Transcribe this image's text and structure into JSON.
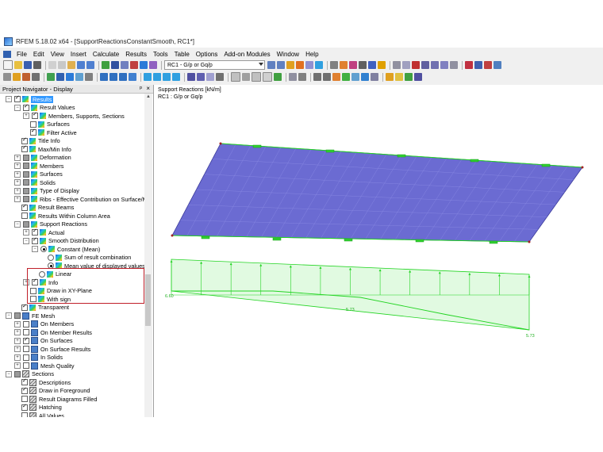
{
  "window": {
    "title": "RFEM 5.18.02 x64 - [SupportReactionsConstantSmooth, RC1*]"
  },
  "menu": [
    "File",
    "Edit",
    "View",
    "Insert",
    "Calculate",
    "Results",
    "Tools",
    "Table",
    "Options",
    "Add-on Modules",
    "Window",
    "Help"
  ],
  "toolbar": {
    "loadcase_combo": "RC1 - G/p or Gq/p"
  },
  "navigator": {
    "title": "Project Navigator - Display",
    "pin": "ᵖ",
    "close": "×",
    "items": [
      {
        "label": "Results",
        "level": 0,
        "exp": "-",
        "cb": "on",
        "icon": "res",
        "selected": true
      },
      {
        "label": "Result Values",
        "level": 1,
        "exp": "-",
        "cb": "on",
        "icon": "res"
      },
      {
        "label": "Members, Supports, Sections",
        "level": 2,
        "exp": "+",
        "cb": "on",
        "icon": "res"
      },
      {
        "label": "Surfaces",
        "level": 2,
        "exp": "",
        "cb": "off",
        "icon": "res"
      },
      {
        "label": "Filter Active",
        "level": 2,
        "exp": "",
        "cb": "on",
        "icon": "res"
      },
      {
        "label": "Title Info",
        "level": 1,
        "exp": "",
        "cb": "on",
        "icon": "res"
      },
      {
        "label": "Max/Min Info",
        "level": 1,
        "exp": "",
        "cb": "on",
        "icon": "res"
      },
      {
        "label": "Deformation",
        "level": 1,
        "exp": "+",
        "cb": "part",
        "icon": "res"
      },
      {
        "label": "Members",
        "level": 1,
        "exp": "+",
        "cb": "part",
        "icon": "res"
      },
      {
        "label": "Surfaces",
        "level": 1,
        "exp": "+",
        "cb": "part",
        "icon": "res"
      },
      {
        "label": "Solids",
        "level": 1,
        "exp": "+",
        "cb": "part",
        "icon": "res"
      },
      {
        "label": "Type of Display",
        "level": 1,
        "exp": "+",
        "cb": "part",
        "icon": "res"
      },
      {
        "label": "Ribs - Effective Contribution on Surface/Me",
        "level": 1,
        "exp": "+",
        "cb": "part",
        "icon": "res"
      },
      {
        "label": "Result Beams",
        "level": 1,
        "exp": "",
        "cb": "on",
        "icon": "res"
      },
      {
        "label": "Results Within Column Area",
        "level": 1,
        "exp": "",
        "cb": "off",
        "icon": "res"
      },
      {
        "label": "Support Reactions",
        "level": 1,
        "exp": "-",
        "cb": "part",
        "icon": "res"
      },
      {
        "label": "Actual",
        "level": 2,
        "exp": "+",
        "cb": "on",
        "icon": "res"
      },
      {
        "label": "Smooth Distribution",
        "level": 2,
        "exp": "-",
        "cb": "on",
        "icon": "res"
      },
      {
        "label": "Constant (Mean)",
        "level": 3,
        "exp": "-",
        "rad": "on",
        "icon": "res"
      },
      {
        "label": "Sum of result combination",
        "level": 4,
        "exp": "",
        "rad": "off",
        "icon": "res"
      },
      {
        "label": "Mean value of displayed values",
        "level": 4,
        "exp": "",
        "rad": "on",
        "icon": "res"
      },
      {
        "label": "Linear",
        "level": 3,
        "exp": "",
        "rad": "off",
        "icon": "res"
      },
      {
        "label": "Info",
        "level": 2,
        "exp": "+",
        "cb": "on",
        "icon": "res"
      },
      {
        "label": "Draw in XY-Plane",
        "level": 2,
        "exp": "",
        "cb": "off",
        "icon": "res"
      },
      {
        "label": "With sign",
        "level": 2,
        "exp": "",
        "cb": "off",
        "icon": "res"
      },
      {
        "label": "Transparent",
        "level": 1,
        "exp": "",
        "cb": "on",
        "icon": "res"
      },
      {
        "label": "FE Mesh",
        "level": 0,
        "exp": "-",
        "cb": "part",
        "icon": "mesh"
      },
      {
        "label": "On Members",
        "level": 1,
        "exp": "+",
        "cb": "off",
        "icon": "mesh"
      },
      {
        "label": "On Member Results",
        "level": 1,
        "exp": "+",
        "cb": "off",
        "icon": "mesh"
      },
      {
        "label": "On Surfaces",
        "level": 1,
        "exp": "+",
        "cb": "on",
        "icon": "mesh"
      },
      {
        "label": "On Surface Results",
        "level": 1,
        "exp": "+",
        "cb": "off",
        "icon": "mesh"
      },
      {
        "label": "In Solids",
        "level": 1,
        "exp": "+",
        "cb": "off",
        "icon": "mesh"
      },
      {
        "label": "Mesh Quality",
        "level": 1,
        "exp": "+",
        "cb": "off",
        "icon": "mesh"
      },
      {
        "label": "Sections",
        "level": 0,
        "exp": "-",
        "cb": "part",
        "icon": "sec"
      },
      {
        "label": "Descriptions",
        "level": 1,
        "exp": "",
        "cb": "on",
        "icon": "sec"
      },
      {
        "label": "Draw in Foreground",
        "level": 1,
        "exp": "",
        "cb": "on",
        "icon": "sec"
      },
      {
        "label": "Result Diagrams Filled",
        "level": 1,
        "exp": "",
        "cb": "off",
        "icon": "sec"
      },
      {
        "label": "Hatching",
        "level": 1,
        "exp": "",
        "cb": "on",
        "icon": "sec"
      },
      {
        "label": "All Values",
        "level": 1,
        "exp": "",
        "cb": "off",
        "icon": "sec"
      }
    ]
  },
  "viewport": {
    "line1": "Support Reactions [kN/m]",
    "line2": "RC1 : G/p or Gq/p",
    "values": {
      "left": "6.60",
      "mid": "5.73",
      "right": "5.73"
    }
  },
  "colors": {
    "plate": "#6b6bd2",
    "diagram": "#22d422",
    "highlight": "#c0202a",
    "selection": "#3399ff"
  }
}
